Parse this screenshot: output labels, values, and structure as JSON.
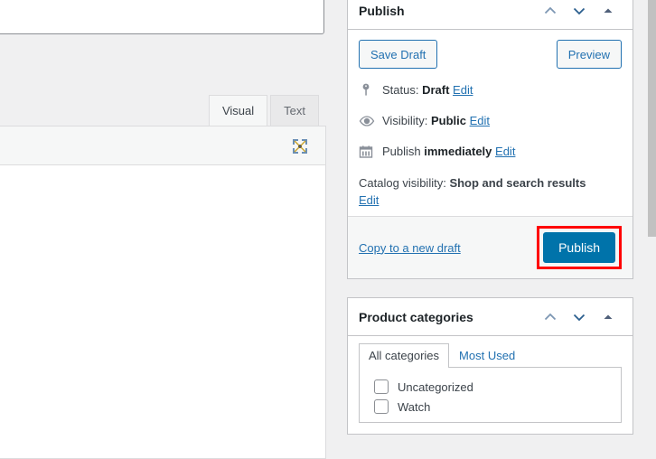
{
  "editor": {
    "title_value": "",
    "title_placeholder": "",
    "tabs": [
      {
        "label": "Visual",
        "active": true
      },
      {
        "label": "Text",
        "active": false
      }
    ],
    "fullscreen_icon": "distraction-free-mode-icon"
  },
  "publish_box": {
    "title": "Publish",
    "controls": {
      "order_up_icon": "chevron-up-icon",
      "order_down_icon": "chevron-down-icon",
      "toggle_icon": "triangle-up-icon"
    },
    "save_draft_label": "Save Draft",
    "preview_label": "Preview",
    "rows": [
      {
        "icon": "pin-icon",
        "prefix": "Status: ",
        "value": "Draft",
        "suffix": "",
        "edit_label": "Edit"
      },
      {
        "icon": "eye-icon",
        "prefix": "Visibility: ",
        "value": "Public",
        "suffix": "",
        "edit_label": "Edit"
      },
      {
        "icon": "calendar-icon",
        "prefix": "Publish ",
        "value": "immediately",
        "suffix": "",
        "edit_label": "Edit"
      }
    ],
    "catalog": {
      "prefix": "Catalog visibility: ",
      "value": "Shop and search results",
      "edit_label": "Edit"
    },
    "copy_draft_label": "Copy to a new draft",
    "publish_label": "Publish",
    "publish_button_color": "#0073aa",
    "highlight_color": "#ff0000"
  },
  "categories_box": {
    "title": "Product categories",
    "controls": {
      "order_up_icon": "chevron-up-icon",
      "order_down_icon": "chevron-down-icon",
      "toggle_icon": "triangle-up-icon"
    },
    "tabs": [
      {
        "label": "All categories",
        "active": true
      },
      {
        "label": "Most Used",
        "active": false
      }
    ],
    "items": [
      {
        "label": "Uncategorized",
        "checked": false
      },
      {
        "label": "Watch",
        "checked": false
      }
    ]
  },
  "scrollbar": {
    "thumb_color": "#c1c1c1",
    "track_color": "#f0f0f1"
  }
}
